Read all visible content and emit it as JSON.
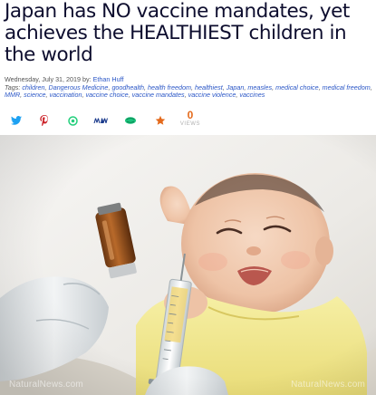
{
  "article": {
    "headline": "Japan has NO vaccine mandates, yet achieves the HEALTHIEST children in the world",
    "date": "Wednesday, July 31, 2019",
    "by_label": "by:",
    "author": "Ethan Huff",
    "tags_label": "Tags:",
    "tags": [
      "children",
      "Dangerous Medicine",
      "goodhealth",
      "health freedom",
      "healthiest",
      "Japan",
      "measles",
      "medical choice",
      "medical freedom",
      "MMR",
      "science",
      "vaccination",
      "vaccine choice",
      "vaccine mandates",
      "vaccine violence",
      "vaccines"
    ]
  },
  "share": {
    "buttons": [
      {
        "icon": "twitter-icon",
        "color": "#1da1f2"
      },
      {
        "icon": "pinterest-icon",
        "color": "#cb2027"
      },
      {
        "icon": "gab-icon",
        "color": "#21cf7b"
      },
      {
        "icon": "mewe-icon",
        "color": "#1a3a8c"
      },
      {
        "icon": "parler-icon",
        "color": "#19c27b"
      },
      {
        "icon": "bookmark-star-icon",
        "color": "#e46a1c"
      }
    ],
    "views_count": "0",
    "views_label": "VIEWS"
  },
  "hero": {
    "watermark_left": "NaturalNews.com",
    "watermark_right": "NaturalNews.com"
  },
  "colors": {
    "headline": "#0d0d2e",
    "link": "#2a56c6",
    "accent": "#e46a1c"
  }
}
